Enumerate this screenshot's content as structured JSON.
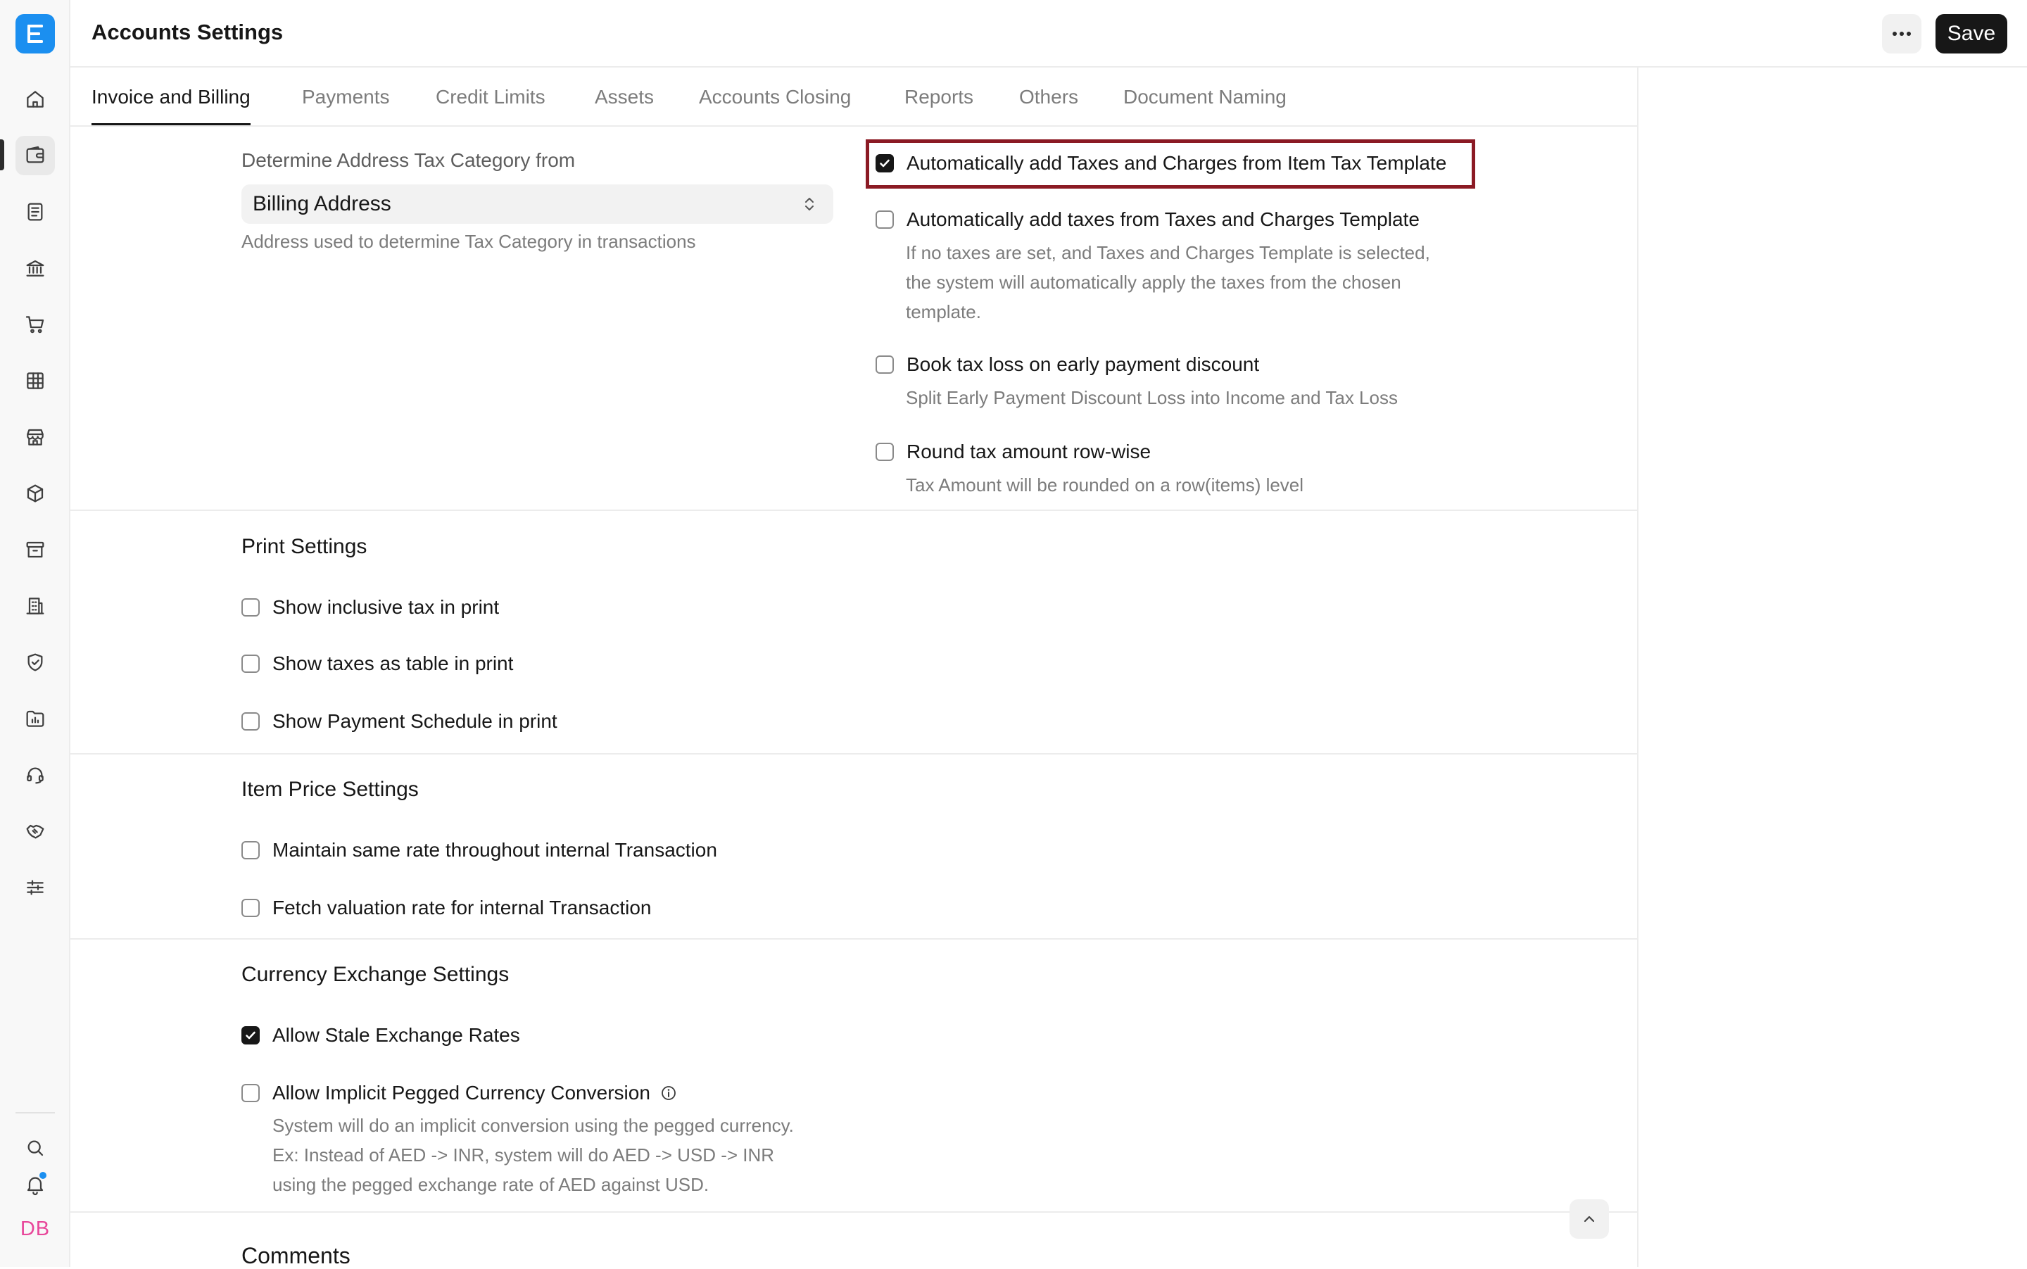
{
  "app": {
    "logo_letter": "E",
    "accent_color": "#1b8ff0",
    "avatar_initials": "DB"
  },
  "sidebar": {
    "items": [
      {
        "icon": "home-icon"
      },
      {
        "icon": "wallet-icon",
        "active": true
      },
      {
        "icon": "document-icon"
      },
      {
        "icon": "bank-icon"
      },
      {
        "icon": "cart-icon"
      },
      {
        "icon": "table-icon"
      },
      {
        "icon": "store-icon"
      },
      {
        "icon": "box-icon"
      },
      {
        "icon": "archive-icon"
      },
      {
        "icon": "building-icon"
      },
      {
        "icon": "shield-icon"
      },
      {
        "icon": "folder-chart-icon"
      },
      {
        "icon": "headset-icon"
      },
      {
        "icon": "handshake-icon"
      },
      {
        "icon": "sliders-icon"
      }
    ],
    "bottom": [
      {
        "icon": "search-icon"
      },
      {
        "icon": "bell-icon"
      }
    ]
  },
  "header": {
    "title": "Accounts Settings",
    "more_label": "···",
    "save_label": "Save"
  },
  "tabs": [
    {
      "label": "Invoice and Billing",
      "active": true
    },
    {
      "label": "Payments"
    },
    {
      "label": "Credit Limits"
    },
    {
      "label": "Assets"
    },
    {
      "label": "Accounts Closing"
    },
    {
      "label": "Reports"
    },
    {
      "label": "Others"
    },
    {
      "label": "Document Naming"
    }
  ],
  "tax": {
    "address_label": "Determine Address Tax Category from",
    "address_value": "Billing Address",
    "address_help": "Address used to determine Tax Category in transactions",
    "options": [
      {
        "label": "Automatically add Taxes and Charges from Item Tax Template",
        "checked": true,
        "highlighted": true
      },
      {
        "label": "Automatically add taxes from Taxes and Charges Template",
        "checked": false,
        "help_lines": [
          "If no taxes are set, and Taxes and Charges Template is selected,",
          "the system will automatically apply the taxes from the chosen",
          "template."
        ]
      },
      {
        "label": "Book tax loss on early payment discount",
        "checked": false,
        "help_lines": [
          "Split Early Payment Discount Loss into Income and Tax Loss"
        ]
      },
      {
        "label": "Round tax amount row-wise",
        "checked": false,
        "help_lines": [
          "Tax Amount will be rounded on a row(items) level"
        ]
      }
    ]
  },
  "print_settings": {
    "title": "Print Settings",
    "options": [
      {
        "label": "Show inclusive tax in print",
        "checked": false
      },
      {
        "label": "Show taxes as table in print",
        "checked": false
      },
      {
        "label": "Show Payment Schedule in print",
        "checked": false
      }
    ]
  },
  "item_price_settings": {
    "title": "Item Price Settings",
    "options": [
      {
        "label": "Maintain same rate throughout internal Transaction",
        "checked": false
      },
      {
        "label": "Fetch valuation rate for internal Transaction",
        "checked": false
      }
    ]
  },
  "currency_exchange_settings": {
    "title": "Currency Exchange Settings",
    "options": [
      {
        "label": "Allow Stale Exchange Rates",
        "checked": true
      },
      {
        "label": "Allow Implicit Pegged Currency Conversion",
        "checked": false,
        "info_icon": "info-icon",
        "help_lines": [
          "System will do an implicit conversion using the pegged currency.",
          "Ex: Instead of AED -> INR, system will do AED -> USD -> INR",
          "using the pegged exchange rate of AED against USD."
        ]
      }
    ]
  },
  "comments": {
    "title": "Comments"
  },
  "colors": {
    "highlight_border": "#8b1a24",
    "checkbox_checked": "#171717",
    "notification_dot": "#1b8ff0",
    "avatar_text": "#e8479a"
  }
}
